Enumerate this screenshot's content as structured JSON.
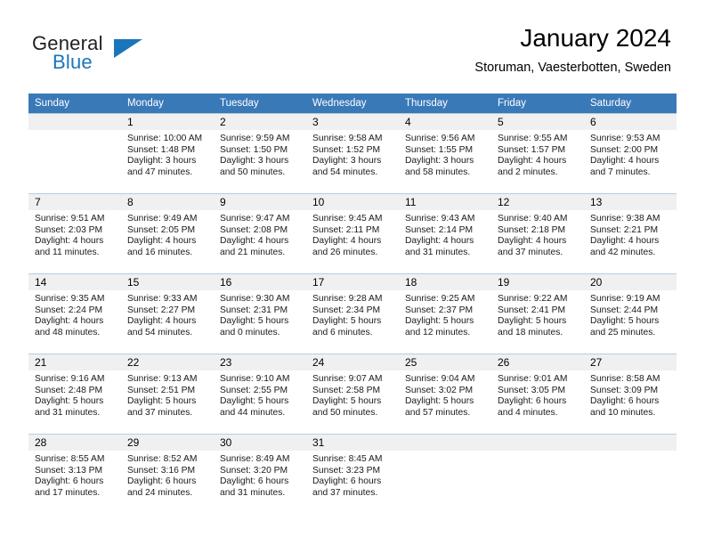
{
  "brand": {
    "name_part1": "General",
    "name_part2": "Blue",
    "accent_color": "#1b75bb"
  },
  "header": {
    "title": "January 2024",
    "subtitle": "Storuman, Vaesterbotten, Sweden"
  },
  "calendar": {
    "header_color": "#3a79b8",
    "weekday_headers": [
      "Sunday",
      "Monday",
      "Tuesday",
      "Wednesday",
      "Thursday",
      "Friday",
      "Saturday"
    ],
    "weeks": [
      [
        {
          "day": "",
          "lines": []
        },
        {
          "day": "1",
          "lines": [
            "Sunrise: 10:00 AM",
            "Sunset: 1:48 PM",
            "Daylight: 3 hours",
            "and 47 minutes."
          ]
        },
        {
          "day": "2",
          "lines": [
            "Sunrise: 9:59 AM",
            "Sunset: 1:50 PM",
            "Daylight: 3 hours",
            "and 50 minutes."
          ]
        },
        {
          "day": "3",
          "lines": [
            "Sunrise: 9:58 AM",
            "Sunset: 1:52 PM",
            "Daylight: 3 hours",
            "and 54 minutes."
          ]
        },
        {
          "day": "4",
          "lines": [
            "Sunrise: 9:56 AM",
            "Sunset: 1:55 PM",
            "Daylight: 3 hours",
            "and 58 minutes."
          ]
        },
        {
          "day": "5",
          "lines": [
            "Sunrise: 9:55 AM",
            "Sunset: 1:57 PM",
            "Daylight: 4 hours",
            "and 2 minutes."
          ]
        },
        {
          "day": "6",
          "lines": [
            "Sunrise: 9:53 AM",
            "Sunset: 2:00 PM",
            "Daylight: 4 hours",
            "and 7 minutes."
          ]
        }
      ],
      [
        {
          "day": "7",
          "lines": [
            "Sunrise: 9:51 AM",
            "Sunset: 2:03 PM",
            "Daylight: 4 hours",
            "and 11 minutes."
          ]
        },
        {
          "day": "8",
          "lines": [
            "Sunrise: 9:49 AM",
            "Sunset: 2:05 PM",
            "Daylight: 4 hours",
            "and 16 minutes."
          ]
        },
        {
          "day": "9",
          "lines": [
            "Sunrise: 9:47 AM",
            "Sunset: 2:08 PM",
            "Daylight: 4 hours",
            "and 21 minutes."
          ]
        },
        {
          "day": "10",
          "lines": [
            "Sunrise: 9:45 AM",
            "Sunset: 2:11 PM",
            "Daylight: 4 hours",
            "and 26 minutes."
          ]
        },
        {
          "day": "11",
          "lines": [
            "Sunrise: 9:43 AM",
            "Sunset: 2:14 PM",
            "Daylight: 4 hours",
            "and 31 minutes."
          ]
        },
        {
          "day": "12",
          "lines": [
            "Sunrise: 9:40 AM",
            "Sunset: 2:18 PM",
            "Daylight: 4 hours",
            "and 37 minutes."
          ]
        },
        {
          "day": "13",
          "lines": [
            "Sunrise: 9:38 AM",
            "Sunset: 2:21 PM",
            "Daylight: 4 hours",
            "and 42 minutes."
          ]
        }
      ],
      [
        {
          "day": "14",
          "lines": [
            "Sunrise: 9:35 AM",
            "Sunset: 2:24 PM",
            "Daylight: 4 hours",
            "and 48 minutes."
          ]
        },
        {
          "day": "15",
          "lines": [
            "Sunrise: 9:33 AM",
            "Sunset: 2:27 PM",
            "Daylight: 4 hours",
            "and 54 minutes."
          ]
        },
        {
          "day": "16",
          "lines": [
            "Sunrise: 9:30 AM",
            "Sunset: 2:31 PM",
            "Daylight: 5 hours",
            "and 0 minutes."
          ]
        },
        {
          "day": "17",
          "lines": [
            "Sunrise: 9:28 AM",
            "Sunset: 2:34 PM",
            "Daylight: 5 hours",
            "and 6 minutes."
          ]
        },
        {
          "day": "18",
          "lines": [
            "Sunrise: 9:25 AM",
            "Sunset: 2:37 PM",
            "Daylight: 5 hours",
            "and 12 minutes."
          ]
        },
        {
          "day": "19",
          "lines": [
            "Sunrise: 9:22 AM",
            "Sunset: 2:41 PM",
            "Daylight: 5 hours",
            "and 18 minutes."
          ]
        },
        {
          "day": "20",
          "lines": [
            "Sunrise: 9:19 AM",
            "Sunset: 2:44 PM",
            "Daylight: 5 hours",
            "and 25 minutes."
          ]
        }
      ],
      [
        {
          "day": "21",
          "lines": [
            "Sunrise: 9:16 AM",
            "Sunset: 2:48 PM",
            "Daylight: 5 hours",
            "and 31 minutes."
          ]
        },
        {
          "day": "22",
          "lines": [
            "Sunrise: 9:13 AM",
            "Sunset: 2:51 PM",
            "Daylight: 5 hours",
            "and 37 minutes."
          ]
        },
        {
          "day": "23",
          "lines": [
            "Sunrise: 9:10 AM",
            "Sunset: 2:55 PM",
            "Daylight: 5 hours",
            "and 44 minutes."
          ]
        },
        {
          "day": "24",
          "lines": [
            "Sunrise: 9:07 AM",
            "Sunset: 2:58 PM",
            "Daylight: 5 hours",
            "and 50 minutes."
          ]
        },
        {
          "day": "25",
          "lines": [
            "Sunrise: 9:04 AM",
            "Sunset: 3:02 PM",
            "Daylight: 5 hours",
            "and 57 minutes."
          ]
        },
        {
          "day": "26",
          "lines": [
            "Sunrise: 9:01 AM",
            "Sunset: 3:05 PM",
            "Daylight: 6 hours",
            "and 4 minutes."
          ]
        },
        {
          "day": "27",
          "lines": [
            "Sunrise: 8:58 AM",
            "Sunset: 3:09 PM",
            "Daylight: 6 hours",
            "and 10 minutes."
          ]
        }
      ],
      [
        {
          "day": "28",
          "lines": [
            "Sunrise: 8:55 AM",
            "Sunset: 3:13 PM",
            "Daylight: 6 hours",
            "and 17 minutes."
          ]
        },
        {
          "day": "29",
          "lines": [
            "Sunrise: 8:52 AM",
            "Sunset: 3:16 PM",
            "Daylight: 6 hours",
            "and 24 minutes."
          ]
        },
        {
          "day": "30",
          "lines": [
            "Sunrise: 8:49 AM",
            "Sunset: 3:20 PM",
            "Daylight: 6 hours",
            "and 31 minutes."
          ]
        },
        {
          "day": "31",
          "lines": [
            "Sunrise: 8:45 AM",
            "Sunset: 3:23 PM",
            "Daylight: 6 hours",
            "and 37 minutes."
          ]
        },
        {
          "day": "",
          "lines": []
        },
        {
          "day": "",
          "lines": []
        },
        {
          "day": "",
          "lines": []
        }
      ]
    ]
  }
}
